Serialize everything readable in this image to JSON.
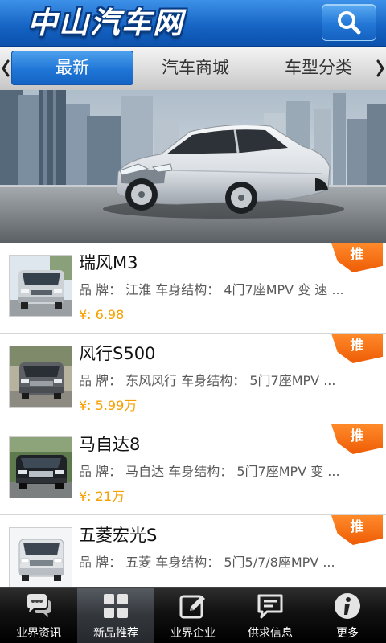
{
  "header": {
    "logo_text": "中山汽车网",
    "search_icon": "search-icon"
  },
  "tabs": {
    "prev_icon": "chevron-left-icon",
    "next_icon": "chevron-right-icon",
    "items": [
      {
        "label": "最新",
        "selected": true
      },
      {
        "label": "汽车商城",
        "selected": false
      },
      {
        "label": "车型分类",
        "selected": false
      }
    ]
  },
  "products": [
    {
      "title": "瑞风M3",
      "details": "品 牌： 江淮 车身结构： 4门7座MPV 变 速 ...",
      "price": "¥: 6.98",
      "badge": "推"
    },
    {
      "title": "风行S500",
      "details": "品 牌： 东风风行 车身结构： 5门7座MPV ...",
      "price": "¥: 5.99万",
      "badge": "推"
    },
    {
      "title": "马自达8",
      "details": "品 牌： 马自达 车身结构： 5门7座MPV 变 ...",
      "price": "¥: 21万",
      "badge": "推"
    },
    {
      "title": "五菱宏光S",
      "details": "品 牌： 五菱 车身结构： 5门5/7/8座MPV ...",
      "badge": "推"
    }
  ],
  "bottom_nav": [
    {
      "label": "业界资讯",
      "icon": "chat-bubbles-icon",
      "selected": false
    },
    {
      "label": "新品推荐",
      "icon": "grid-icon",
      "selected": true
    },
    {
      "label": "业界企业",
      "icon": "edit-icon",
      "selected": false
    },
    {
      "label": "供求信息",
      "icon": "message-icon",
      "selected": false
    },
    {
      "label": "更多",
      "icon": "info-icon",
      "selected": false
    }
  ],
  "colors": {
    "header_blue": "#1462c2",
    "tab_selected_blue": "#1f76d6",
    "price_orange": "#f5a000",
    "badge_orange": "#ee5c06",
    "nav_background": "#111111"
  }
}
